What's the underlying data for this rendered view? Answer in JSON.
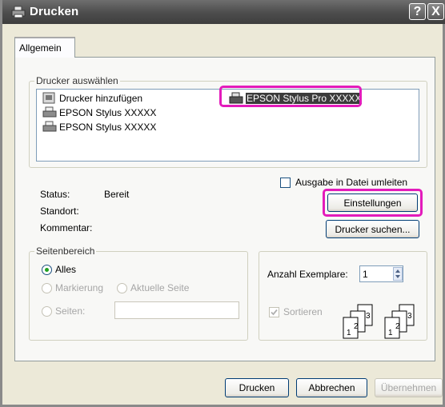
{
  "window": {
    "title": "Drucken",
    "help_label": "?",
    "close_label": "X"
  },
  "tabs": [
    {
      "label": "Allgemein"
    }
  ],
  "printer_select": {
    "group_title": "Drucker auswählen",
    "printers": [
      {
        "label": "Drucker hinzufügen"
      },
      {
        "label": "EPSON Stylus XXXXX"
      },
      {
        "label": "EPSON Stylus XXXXX"
      },
      {
        "label": "EPSON Stylus Pro XXXXX"
      }
    ],
    "print_to_file_label": "Ausgabe in Datei umleiten",
    "status_label": "Status:",
    "status_value": "Bereit",
    "location_label": "Standort:",
    "comment_label": "Kommentar:",
    "settings_button": "Einstellungen",
    "find_printer_button": "Drucker suchen..."
  },
  "page_range": {
    "group_title": "Seitenbereich",
    "all_label": "Alles",
    "selection_label": "Markierung",
    "current_page_label": "Aktuelle Seite",
    "pages_label": "Seiten:",
    "pages_value": ""
  },
  "copies": {
    "label": "Anzahl Exemplare:",
    "value": "1",
    "collate_label": "Sortieren",
    "page_numbers": [
      "1",
      "2",
      "3"
    ]
  },
  "footer": {
    "print_button": "Drucken",
    "cancel_button": "Abbrechen",
    "apply_button": "Übernehmen"
  },
  "colors": {
    "highlight": "#e31bbb",
    "titlebar": "#4c4c4c",
    "radio_dot": "#21a121"
  }
}
